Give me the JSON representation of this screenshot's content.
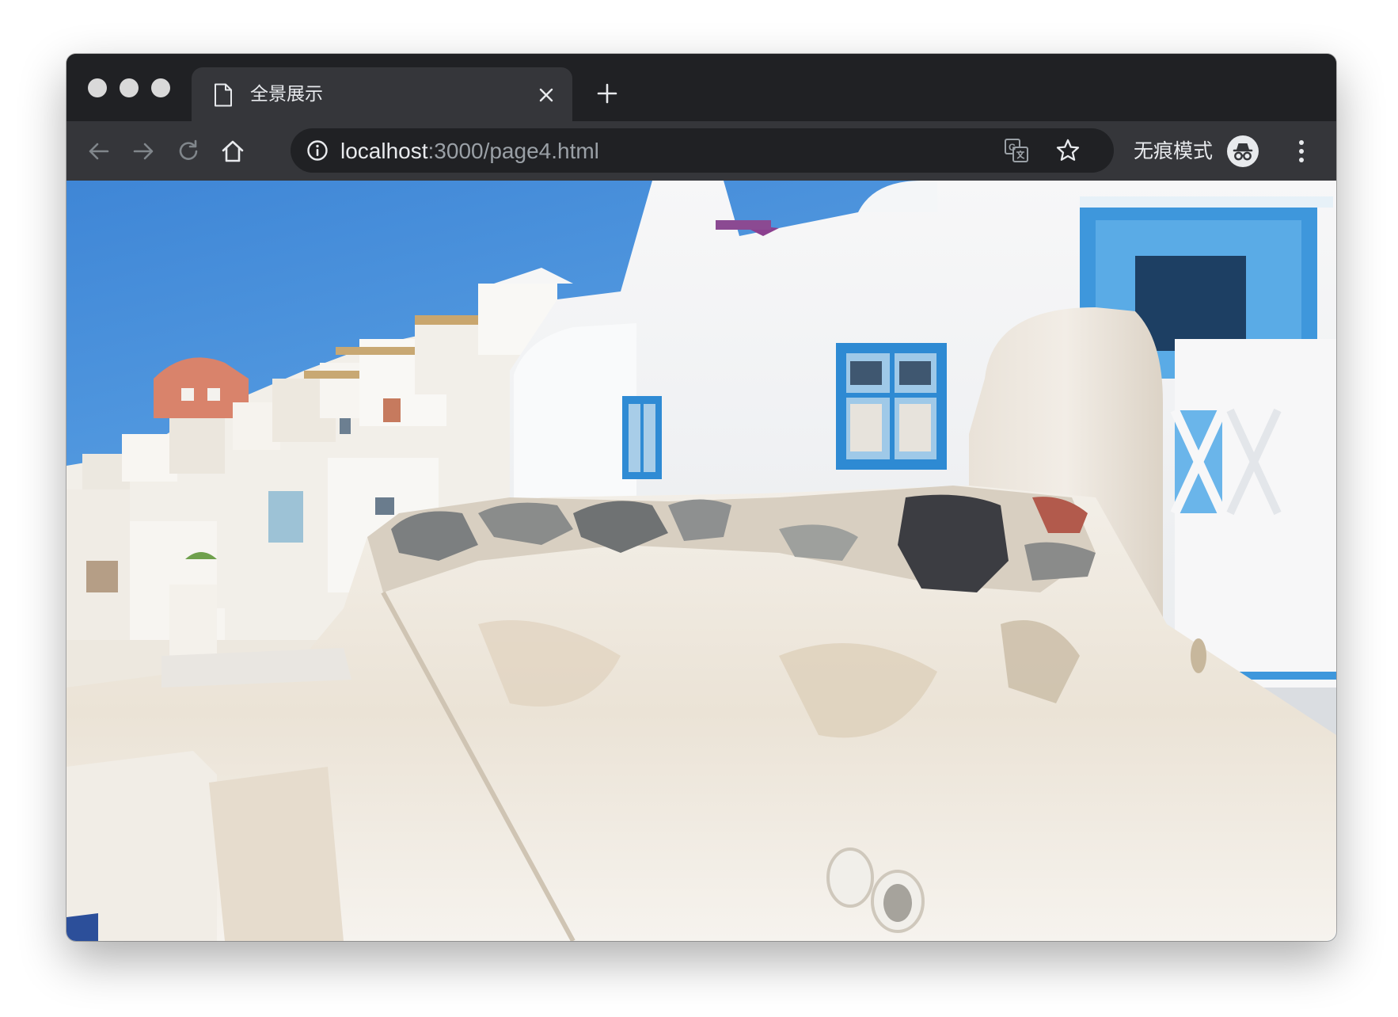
{
  "browser": {
    "tab": {
      "title": "全景展示",
      "icon": "document-icon"
    },
    "address_bar": {
      "host": "localhost",
      "path": ":3000/page4.html"
    },
    "profile": {
      "label": "无痕模式",
      "icon": "incognito-icon"
    }
  },
  "colors": {
    "titlebar": "#202124",
    "toolbar": "#35363a",
    "sky": "#4a90d9",
    "window_blue": "#3a9be0",
    "wall_white": "#f4f2ee"
  },
  "scene": {
    "subject": "panorama"
  }
}
